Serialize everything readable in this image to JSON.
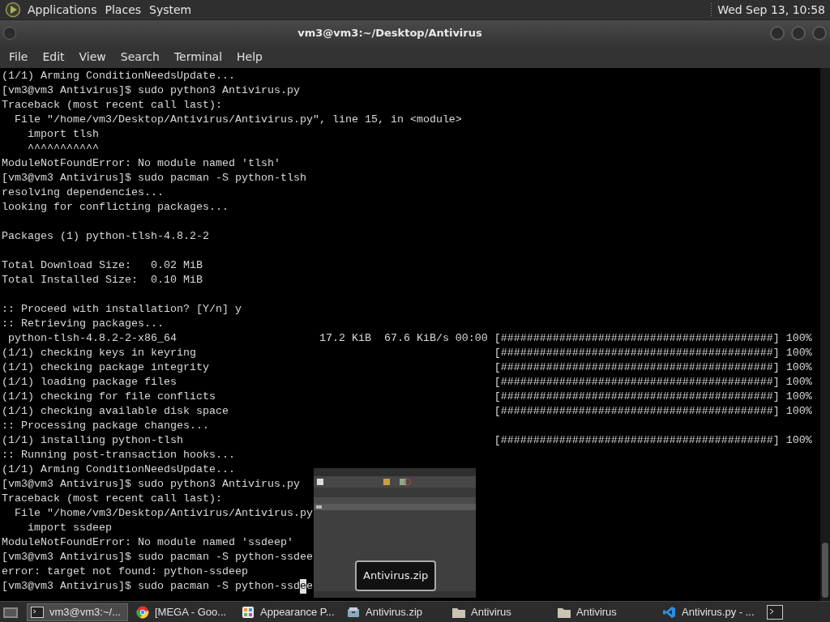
{
  "top_panel": {
    "menus": [
      "Applications",
      "Places",
      "System"
    ],
    "clock": "Wed Sep 13, 10:58"
  },
  "window": {
    "title": "vm3@vm3:~/Desktop/Antivirus"
  },
  "menubar": [
    "File",
    "Edit",
    "View",
    "Search",
    "Terminal",
    "Help"
  ],
  "terminal": {
    "lines": [
      {
        "kind": "text",
        "text": "(1/1) Arming ConditionNeedsUpdate..."
      },
      {
        "kind": "text",
        "text": "[vm3@vm3 Antivirus]$ sudo python3 Antivirus.py"
      },
      {
        "kind": "text",
        "text": "Traceback (most recent call last):"
      },
      {
        "kind": "text",
        "text": "  File \"/home/vm3/Desktop/Antivirus/Antivirus.py\", line 15, in <module>"
      },
      {
        "kind": "text",
        "text": "    import tlsh"
      },
      {
        "kind": "text",
        "text": "    ^^^^^^^^^^^"
      },
      {
        "kind": "text",
        "text": "ModuleNotFoundError: No module named 'tlsh'"
      },
      {
        "kind": "text",
        "text": "[vm3@vm3 Antivirus]$ sudo pacman -S python-tlsh"
      },
      {
        "kind": "text",
        "text": "resolving dependencies..."
      },
      {
        "kind": "text",
        "text": "looking for conflicting packages..."
      },
      {
        "kind": "blank"
      },
      {
        "kind": "text",
        "text": "Packages (1) python-tlsh-4.8.2-2"
      },
      {
        "kind": "blank"
      },
      {
        "kind": "text",
        "text": "Total Download Size:   0.02 MiB"
      },
      {
        "kind": "text",
        "text": "Total Installed Size:  0.10 MiB"
      },
      {
        "kind": "blank"
      },
      {
        "kind": "text",
        "text": ":: Proceed with installation? [Y/n] y"
      },
      {
        "kind": "text",
        "text": ":: Retrieving packages..."
      },
      {
        "kind": "progress",
        "text": " python-tlsh-4.8.2-2-x86_64                      17.2 KiB  67.6 KiB/s 00:00",
        "bar": "[##########################################] 100%"
      },
      {
        "kind": "progress",
        "text": "(1/1) checking keys in keyring",
        "bar": "[##########################################] 100%"
      },
      {
        "kind": "progress",
        "text": "(1/1) checking package integrity",
        "bar": "[##########################################] 100%"
      },
      {
        "kind": "progress",
        "text": "(1/1) loading package files",
        "bar": "[##########################################] 100%"
      },
      {
        "kind": "progress",
        "text": "(1/1) checking for file conflicts",
        "bar": "[##########################################] 100%"
      },
      {
        "kind": "progress",
        "text": "(1/1) checking available disk space",
        "bar": "[##########################################] 100%"
      },
      {
        "kind": "text",
        "text": ":: Processing package changes..."
      },
      {
        "kind": "progress",
        "text": "(1/1) installing python-tlsh",
        "bar": "[##########################################] 100%"
      },
      {
        "kind": "text",
        "text": ":: Running post-transaction hooks..."
      },
      {
        "kind": "text",
        "text": "(1/1) Arming ConditionNeedsUpdate..."
      },
      {
        "kind": "text",
        "text": "[vm3@vm3 Antivirus]$ sudo python3 Antivirus.py"
      },
      {
        "kind": "text",
        "text": "Traceback (most recent call last):"
      },
      {
        "kind": "text",
        "text": "  File \"/home/vm3/Desktop/Antivirus/Antivirus.py"
      },
      {
        "kind": "text",
        "text": "    import ssdeep"
      },
      {
        "kind": "text",
        "text": "ModuleNotFoundError: No module named 'ssdeep'"
      },
      {
        "kind": "text",
        "text": "[vm3@vm3 Antivirus]$ sudo pacman -S python-ssdee"
      },
      {
        "kind": "text",
        "text": "error: target not found: python-ssdeep"
      },
      {
        "kind": "cursor",
        "before": "[vm3@vm3 Antivirus]$ sudo pacman -S python-ssd",
        "at": "e",
        "after": "e"
      }
    ]
  },
  "preview": {
    "kind": "picture",
    "tooltip": "Antivirus.zip"
  },
  "taskbar": {
    "tasks": [
      {
        "kind": "terminal",
        "label": "vm3@vm3:~/...",
        "selected": true
      },
      {
        "kind": "browser",
        "label": "[MEGA - Goo...",
        "selected": false
      },
      {
        "kind": "appearance",
        "label": "Appearance P...",
        "selected": false
      },
      {
        "kind": "archive",
        "label": "Antivirus.zip",
        "selected": false
      },
      {
        "kind": "folder",
        "label": "Antivirus",
        "selected": false
      },
      {
        "kind": "folder",
        "label": "Antivirus",
        "selected": false
      },
      {
        "kind": "code",
        "label": "Antivirus.py - ...",
        "selected": false
      }
    ]
  }
}
